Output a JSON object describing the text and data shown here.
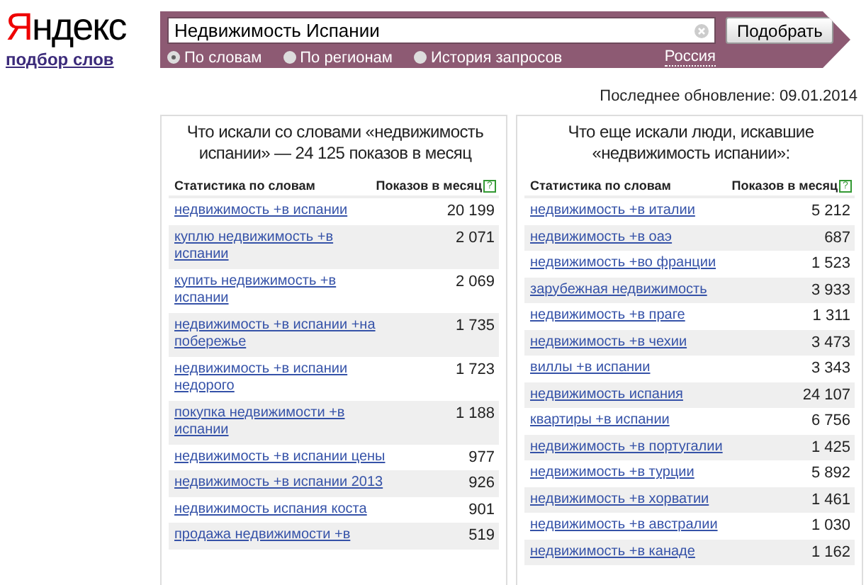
{
  "logo": {
    "text": "Яндекс",
    "service_link": "подбор слов"
  },
  "search": {
    "value": "Недвижимость Испании",
    "button": "Подобрать",
    "modes": [
      {
        "label": "По словам",
        "selected": true
      },
      {
        "label": "По регионам",
        "selected": false
      },
      {
        "label": "История запросов",
        "selected": false
      }
    ],
    "region": "Россия"
  },
  "last_update": "Последнее обновление: 09.01.2014",
  "panels": [
    {
      "title": "Что искали со словами «недвижимость испании» — 24 125 показов в месяц",
      "columns": [
        "Статистика по словам",
        "Показов в месяц"
      ],
      "help": "?",
      "rows": [
        {
          "phrase": "недвижимость +в испании",
          "count": "20 199"
        },
        {
          "phrase": "куплю недвижимость +в испании",
          "count": "2 071"
        },
        {
          "phrase": "купить недвижимость +в испании",
          "count": "2 069"
        },
        {
          "phrase": "недвижимость +в испании +на побережье",
          "count": "1 735"
        },
        {
          "phrase": "недвижимость +в испании недорого",
          "count": "1 723"
        },
        {
          "phrase": "покупка недвижимости +в испании",
          "count": "1 188"
        },
        {
          "phrase": "недвижимость +в испании цены",
          "count": "977"
        },
        {
          "phrase": "недвижимость +в испании 2013",
          "count": "926"
        },
        {
          "phrase": "недвижимость испания коста",
          "count": "901"
        },
        {
          "phrase": "продажа недвижимости +в",
          "count": "519"
        }
      ]
    },
    {
      "title": "Что еще искали люди, искавшие «недвижимость испании»:",
      "columns": [
        "Статистика по словам",
        "Показов в месяц"
      ],
      "help": "?",
      "rows": [
        {
          "phrase": "недвижимость +в италии",
          "count": "5 212"
        },
        {
          "phrase": "недвижимость +в оаэ",
          "count": "687"
        },
        {
          "phrase": "недвижимость +во франции",
          "count": "1 523"
        },
        {
          "phrase": "зарубежная недвижимость",
          "count": "3 933"
        },
        {
          "phrase": "недвижимость +в праге",
          "count": "1 311"
        },
        {
          "phrase": "недвижимость +в чехии",
          "count": "3 473"
        },
        {
          "phrase": "виллы +в испании",
          "count": "3 343"
        },
        {
          "phrase": "недвижимость испания",
          "count": "24 107"
        },
        {
          "phrase": "квартиры +в испании",
          "count": "6 756"
        },
        {
          "phrase": "недвижимость +в португалии",
          "count": "1 425"
        },
        {
          "phrase": "недвижимость +в турции",
          "count": "5 892"
        },
        {
          "phrase": "недвижимость +в хорватии",
          "count": "1 461"
        },
        {
          "phrase": "недвижимость +в австралии",
          "count": "1 030"
        },
        {
          "phrase": "недвижимость +в канаде",
          "count": "1 162"
        }
      ]
    }
  ]
}
